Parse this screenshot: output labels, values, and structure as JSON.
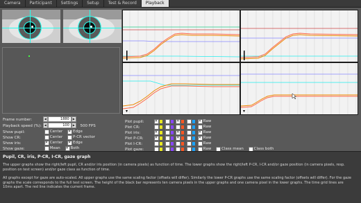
{
  "tabs": [
    {
      "label": "Camera"
    },
    {
      "label": "Participant"
    },
    {
      "label": "Settings"
    },
    {
      "label": "Setup"
    },
    {
      "label": "Test & Record"
    },
    {
      "label": "Playback",
      "active": true
    }
  ],
  "controls": {
    "frame_number": {
      "label": "Frame number:",
      "value": "1880"
    },
    "playback_speed": {
      "label": "Playback speed (%):",
      "value": "100",
      "fps": "500 FPS"
    },
    "show_pupil": {
      "label": "Show pupil:",
      "center": "Center",
      "edge": "Edge",
      "center_checked": false,
      "edge_checked": true
    },
    "show_cr": {
      "label": "Show CR:",
      "center": "Center",
      "pcr": "P-CR vector",
      "center_checked": false,
      "pcr_checked": false
    },
    "show_iris": {
      "label": "Show iris:",
      "center": "Center",
      "edge": "Edge",
      "center_checked": true,
      "edge_checked": true
    },
    "show_gaze": {
      "label": "Show gaze:",
      "mean": "Mean",
      "both": "Both",
      "mean_checked": false,
      "both_checked": true
    }
  },
  "plot_controls": {
    "rows": [
      {
        "label": "Plot pupil:",
        "colors": [
          "#e7e722",
          "#8a46ff",
          "#ff5722",
          "#1aa3ff"
        ],
        "checked": [
          true,
          false,
          true,
          false
        ],
        "raw_checked": true,
        "raw": "Raw"
      },
      {
        "label": "Plot CR:",
        "colors": [
          "#e7e722",
          "#8a46ff",
          "#ff5722",
          "#1aa3ff"
        ],
        "checked": [
          false,
          false,
          false,
          false
        ],
        "raw_checked": false,
        "raw": "Raw"
      },
      {
        "label": "Plot iris:",
        "colors": [
          "#e7e722",
          "#8a46ff",
          "#ff5722",
          "#1aa3ff"
        ],
        "checked": [
          true,
          false,
          true,
          false
        ],
        "raw_checked": true,
        "raw": "Raw"
      },
      {
        "label": "Plot P-CR:",
        "colors": [
          "#e7e722",
          "#8a46ff",
          "#ff5722",
          "#1aa3ff"
        ],
        "checked": [
          true,
          false,
          true,
          false
        ],
        "raw_checked": true,
        "raw": "Raw"
      },
      {
        "label": "Plot I-CR:",
        "colors": [
          "#e7e722",
          "#8a46ff",
          "#ff5722",
          "#1aa3ff"
        ],
        "checked": [
          false,
          false,
          false,
          false
        ],
        "raw_checked": false,
        "raw": "Raw"
      },
      {
        "label": "Plot gaze:",
        "colors": [
          "#e7e722",
          "#8a46ff",
          "#ff5722",
          "#1aa3ff"
        ],
        "checked": [
          false,
          false,
          false,
          false
        ],
        "raw_checked": false,
        "raw": "Raw",
        "class_mean": "Class mean",
        "class_both": "Class both",
        "class_mean_checked": false,
        "class_both_checked": false
      }
    ]
  },
  "info": {
    "title": "Pupil, CR, iris, P-CR, I-CR, gaze graph",
    "p1": "The upper graphs show the right/left pupil, CR and/or iris position (in camera pixels) as function of time. The lower graphs show the right/left P-CR, I-CR and/or gaze position (in camera pixels, resp. position on test screen) and/or gaze class as function of time.",
    "p2": "All graphs except for gaze are auto-scaled. All upper graphs use the same scaling factor (offsets will differ). Similarly the lower P-CR graphs use the same scaling factor (offsets will differ). For the gaze graphs the scale corresponds to the full test screen. The height of the black bar represents ten camera pixels in the upper graphs and one camera pixel in the lower graphs. The time grid lines are 10ms apart. The red line indicates the current frame."
  },
  "colors": {
    "accent": "#2fe",
    "tab_active_bg": "#e2e2e2",
    "panel_bg": "#595959"
  }
}
